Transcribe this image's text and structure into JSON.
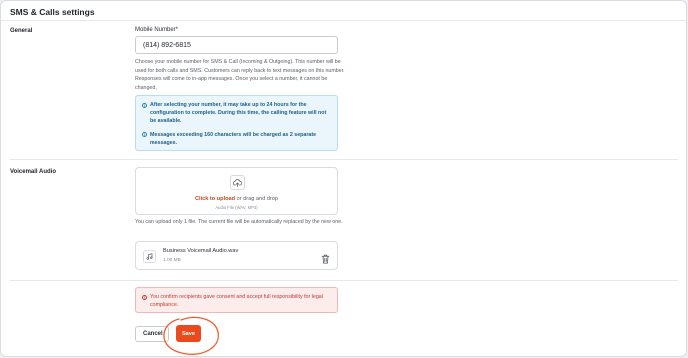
{
  "page": {
    "title": "SMS & Calls settings"
  },
  "general": {
    "section_label": "General",
    "field_label": "Mobile Number*",
    "mobile_number": "(814) 892-6815",
    "help_text": "Choose your mobile number for SMS & Call (Incoming & Outgoing). This number will be used for both calls and SMS. Customers can reply back to text messages on this number. Responses will come to in-app messages. Once you select a number, it cannot be changed.",
    "info_messages": [
      "After selecting your number, it may take up to 24 hours for the configuration to complete. During this time, the calling feature will not be available.",
      "Messages exceeding 160 characters will be charged as 2 separate messages."
    ]
  },
  "voicemail": {
    "section_label": "Voicemail Audio",
    "upload_link": "Click to upload",
    "upload_rest": "or drag and drop",
    "upload_hint": "Audio File (WAV, MP3)",
    "upload_note": "You can upload only 1 file. The current file will be automatically replaced by the new one.",
    "file_name": "Business Voicemail Audio.wav",
    "file_size": "1.00 MB"
  },
  "compliance": {
    "warning": "You confirm recipients gave consent and accept full responsibility for legal compliance."
  },
  "actions": {
    "cancel_label": "Cancel",
    "save_label": "Save"
  },
  "colors": {
    "accent": "#ea4a1e",
    "info_bg": "#eaf5fc",
    "info_text": "#1d5f8a",
    "warning_bg": "#fdecec",
    "warning_text": "#c23a2b",
    "annotation": "#f25c2b"
  },
  "icons": {
    "info": "info-circle-icon",
    "upload": "cloud-upload-icon",
    "file": "music-note-icon",
    "delete": "trash-icon",
    "warning": "alert-circle-icon"
  }
}
